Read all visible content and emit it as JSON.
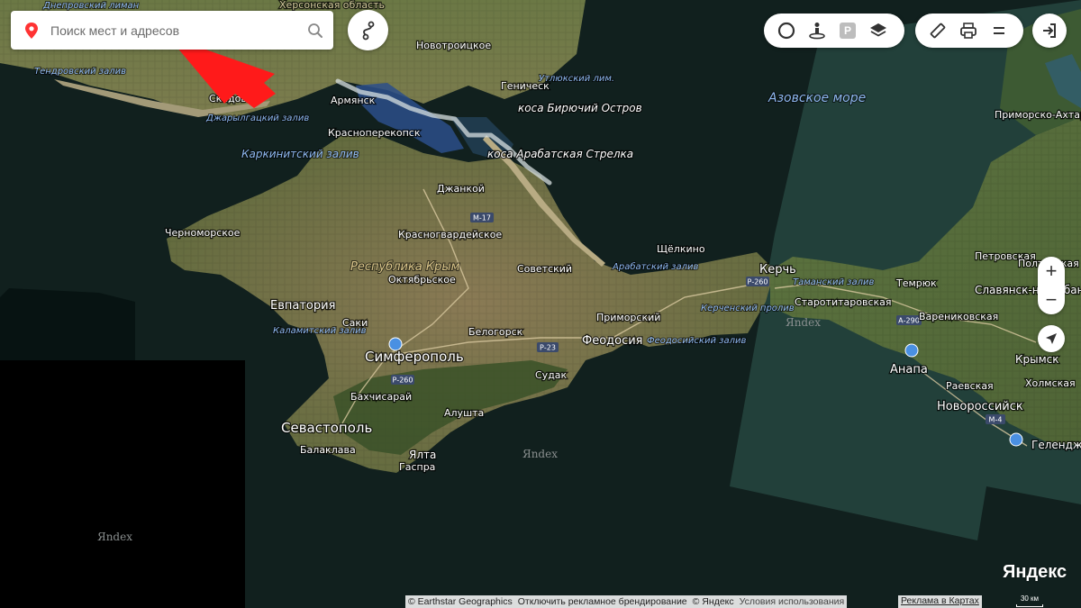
{
  "search": {
    "placeholder": "Поиск мест и адресов"
  },
  "toolbar": {
    "traffic_icon": "traffic-icon",
    "panorama_icon": "panorama-icon",
    "parking_label": "P",
    "layers_icon": "layers-icon",
    "ruler_icon": "ruler-icon",
    "print_icon": "print-icon",
    "menu_icon": "menu-icon",
    "login_icon": "login-icon"
  },
  "zoom": {
    "in_label": "+",
    "out_label": "−"
  },
  "map": {
    "places": {
      "khersonskaya_oblast": "Херсонская область",
      "dneprovsky_liman": "Днепровский лиман",
      "novotroitskoe": "Новотроицкое",
      "tendrovsky_zaliv": "Тендровский залив",
      "skadovsk": "Скадовск",
      "dzharylgatsky_zaliv": "Джарылгацкий залив",
      "armyansk": "Армянск",
      "genichesk": "Геническ",
      "utlyuksky_liman": "Утлюкский лим.",
      "kosa_biryuchiy": "коса Бирючий Остров",
      "krasnoperekopsk": "Красноперекопск",
      "karkinitsky_zaliv": "Каркинитский залив",
      "kosa_arabatskaya": "коса Арабатская Стрелка",
      "dzhankoy": "Джанкой",
      "azov_sea": "Азовское море",
      "primorsko_akhtarsk": "Приморско-Ахтарск",
      "chernomorskoe": "Черноморское",
      "krasnogvardeyskoe": "Красногвардейское",
      "shchelkino": "Щёлкино",
      "respublika_krym": "Республика Крым",
      "sovetsky": "Советский",
      "arabatsky_zaliv": "Арабатский залив",
      "kerch": "Керчь",
      "oktyabrskoe": "Октябрьское",
      "petrovskaya": "Петровская",
      "poltavskaya": "Полтавская",
      "tamansky_zaliv": "Таманский залив",
      "temryuk": "Темрюк",
      "slavyansk": "Славянск-на-Кубани",
      "starotitarovskaya": "Старотитаровская",
      "evpatoriya": "Евпатория",
      "kerchensky_proliv": "Керченский пролив",
      "saki": "Саки",
      "primorsky": "Приморский",
      "varenikovskaya": "Варениковская",
      "kalamitsky_zaliv": "Каламитский залив",
      "belogorsk": "Белогорск",
      "feodosiya": "Феодосия",
      "feodosiysky_zaliv": "Феодосийский залив",
      "simferopol": "Симферополь",
      "anapa": "Анапа",
      "krymsk": "Крымск",
      "sudak": "Судак",
      "raevskaya": "Раевская",
      "kholmskaya": "Холмская",
      "bakhchisaray": "Бахчисарай",
      "novorossiysk": "Новороссийск",
      "alushta": "Алушта",
      "sevastopol": "Севастополь",
      "gelendzhik": "Геленджик",
      "balaklava": "Балаклава",
      "yalta": "Ялта",
      "gaspra": "Гаспра"
    },
    "roads": {
      "m17": "М-17",
      "r260": "Р-260",
      "r23": "Р-23",
      "a290": "А-290",
      "m4": "М-4"
    },
    "watermark": "Яndex"
  },
  "footer": {
    "copyright": "© Earthstar Geographics",
    "disable_branding": "Отключить рекламное брендирование",
    "yandex_copyright": "© Яндекс",
    "terms": "Условия использования",
    "ads": "Реклама в Картах",
    "logo": "Яндекс",
    "scale": "30 км"
  }
}
